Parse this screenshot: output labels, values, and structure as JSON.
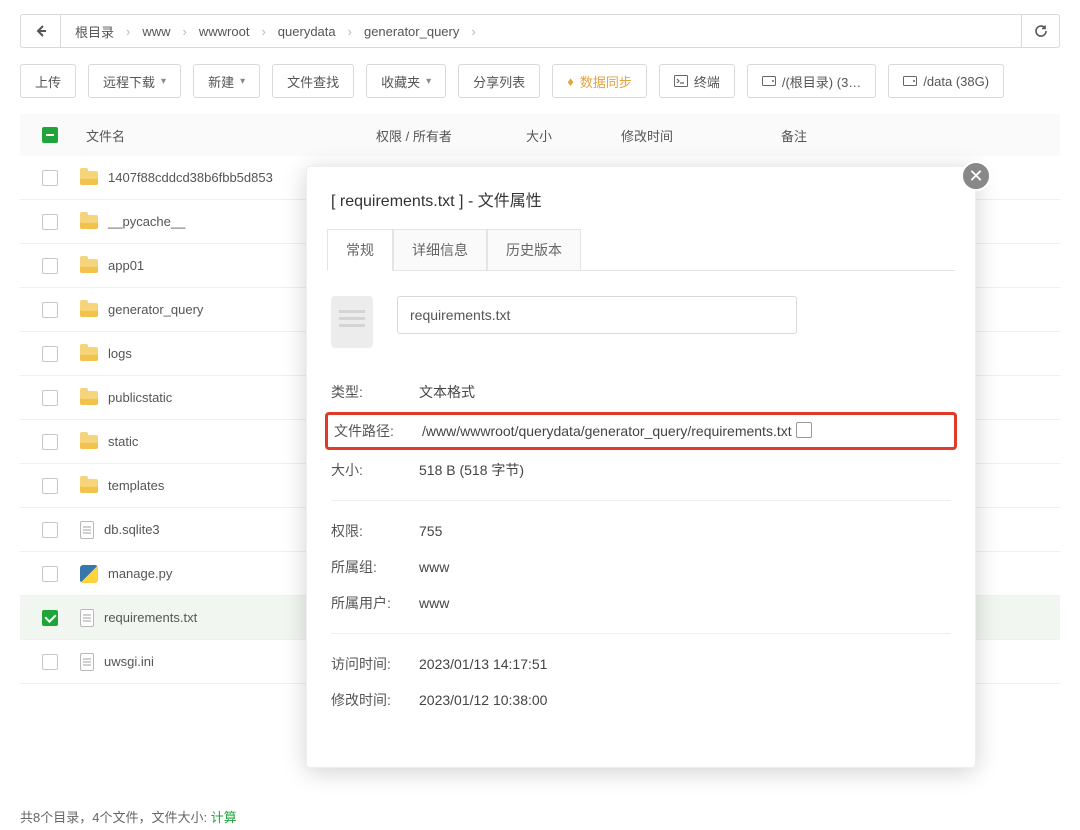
{
  "breadcrumb": {
    "items": [
      "根目录",
      "www",
      "wwwroot",
      "querydata",
      "generator_query"
    ]
  },
  "toolbar": {
    "upload": "上传",
    "remote_download": "远程下载",
    "new": "新建",
    "file_search": "文件查找",
    "favorites": "收藏夹",
    "share_list": "分享列表",
    "data_sync": "数据同步",
    "terminal": "终端",
    "disk_root": "/(根目录) (3…",
    "disk_data": "/data (38G)"
  },
  "columns": {
    "name": "文件名",
    "perm": "权限 / 所有者",
    "size": "大小",
    "mtime": "修改时间",
    "note": "备注"
  },
  "rows": [
    {
      "icon": "folder",
      "name": "1407f88cddcd38b6fbb5d853",
      "selected": false
    },
    {
      "icon": "folder",
      "name": "__pycache__",
      "selected": false
    },
    {
      "icon": "folder",
      "name": "app01",
      "selected": false
    },
    {
      "icon": "folder",
      "name": "generator_query",
      "selected": false
    },
    {
      "icon": "folder",
      "name": "logs",
      "selected": false
    },
    {
      "icon": "folder",
      "name": "publicstatic",
      "selected": false
    },
    {
      "icon": "folder",
      "name": "static",
      "selected": false
    },
    {
      "icon": "folder",
      "name": "templates",
      "selected": false
    },
    {
      "icon": "file",
      "name": "db.sqlite3",
      "selected": false
    },
    {
      "icon": "python",
      "name": "manage.py",
      "selected": false
    },
    {
      "icon": "file",
      "name": "requirements.txt",
      "selected": true
    },
    {
      "icon": "file",
      "name": "uwsgi.ini",
      "selected": false
    }
  ],
  "footer": {
    "text_prefix": "共8个目录，4个文件，文件大小: ",
    "calc": "计算"
  },
  "modal": {
    "title": "[ requirements.txt ] - 文件属性",
    "tabs": {
      "general": "常规",
      "details": "详细信息",
      "history": "历史版本"
    },
    "filename": "requirements.txt",
    "labels": {
      "type": "类型:",
      "path": "文件路径:",
      "size": "大小:",
      "perm": "权限:",
      "group": "所属组:",
      "user": "所属用户:",
      "atime": "访问时间:",
      "mtime": "修改时间:"
    },
    "values": {
      "type": "文本格式",
      "path": "/www/wwwroot/querydata/generator_query/requirements.txt",
      "size": "518 B (518 字节)",
      "perm": "755",
      "group": "www",
      "user": "www",
      "atime": "2023/01/13 14:17:51",
      "mtime": "2023/01/12 10:38:00"
    }
  }
}
